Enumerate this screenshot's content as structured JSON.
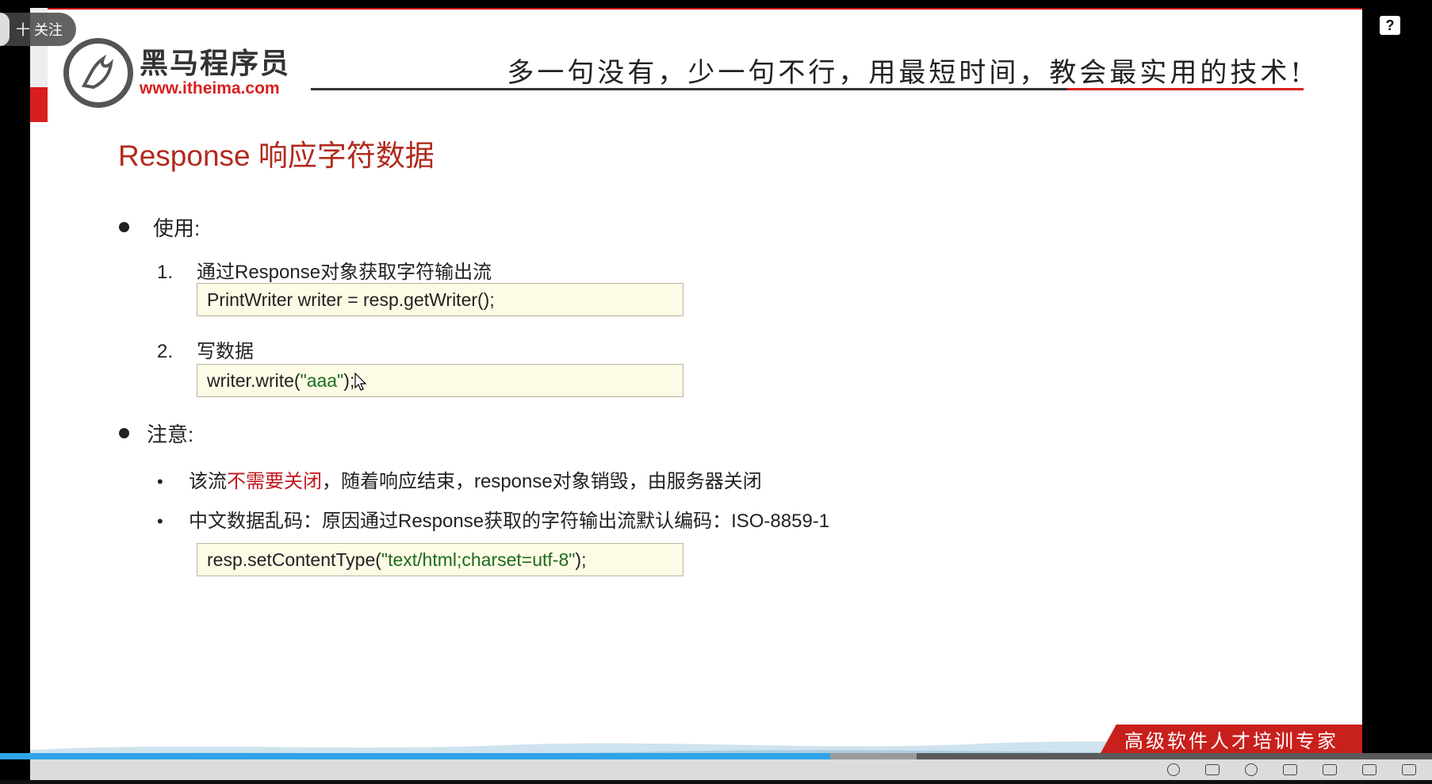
{
  "overlay": {
    "follow_label": "十 关注"
  },
  "header": {
    "logo_cn": "黑马程序员",
    "logo_url": "www.itheima.com",
    "slogan": "多一句没有，少一句不行，用最短时间，教会最实用的技术!"
  },
  "slide": {
    "title": "Response 响应字符数据",
    "usage": {
      "label": "使用:",
      "steps": [
        {
          "num": "1.",
          "text": "通过Response对象获取字符输出流",
          "code": "PrintWriter writer = resp.getWriter();"
        },
        {
          "num": "2.",
          "text": "写数据",
          "code_pre": "writer.write(",
          "code_str": "\"aaa\"",
          "code_post": ");"
        }
      ]
    },
    "notes": {
      "label": "注意:",
      "items": [
        {
          "pre": "该流",
          "emph": "不需要关闭",
          "post": "，随着响应结束，response对象销毁，由服务器关闭"
        },
        {
          "text": "中文数据乱码：原因通过Response获取的字符输出流默认编码：ISO-8859-1"
        }
      ],
      "code_pre": "resp.setContentType(",
      "code_str": "\"text/html;charset=utf-8\"",
      "code_post": ");"
    }
  },
  "footer": {
    "banner": "高级软件人才培训专家"
  },
  "player": {
    "progress_percent": 58
  },
  "icons": {
    "help": "help-icon",
    "cursor": "mouse-cursor-icon"
  }
}
